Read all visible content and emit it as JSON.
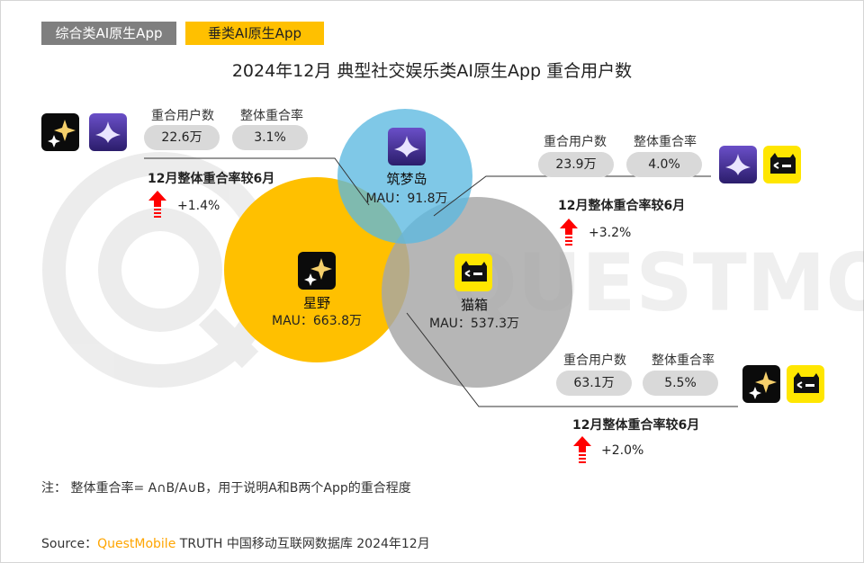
{
  "tags": {
    "general": "综合类AI原生App",
    "vertical": "垂类AI原生App"
  },
  "title": "2024年12月 典型社交娱乐类AI原生App 重合用户数",
  "watermark": "QUESTMOBILE",
  "colors": {
    "xingye": "#ffc000",
    "zhumengdao": "#5bb8e0",
    "maoxiang": "#a6a6a6",
    "arrow": "#ff0000",
    "brand": "#ffa500"
  },
  "chart_data": {
    "type": "venn",
    "sets": [
      {
        "name": "星野",
        "mau_label": "MAU：663.8万",
        "mau": 663.8,
        "icon": "sparkle-icon"
      },
      {
        "name": "筑梦岛",
        "mau_label": "MAU：91.8万",
        "mau": 91.8,
        "icon": "star-glow-icon"
      },
      {
        "name": "猫箱",
        "mau_label": "MAU：537.3万",
        "mau": 537.3,
        "icon": "cat-box-icon"
      }
    ],
    "overlaps": [
      {
        "pair": [
          "星野",
          "筑梦岛"
        ],
        "overlap_header": "重合用户数",
        "rate_header": "整体重合率",
        "overlap_label": "22.6万",
        "rate_label": "3.1%",
        "overlap_users": 22.6,
        "overlap_rate": 3.1,
        "compare_label": "12月整体重合率较6月",
        "delta_label": "+1.4%",
        "delta": 1.4
      },
      {
        "pair": [
          "筑梦岛",
          "猫箱"
        ],
        "overlap_header": "重合用户数",
        "rate_header": "整体重合率",
        "overlap_label": "23.9万",
        "rate_label": "4.0%",
        "overlap_users": 23.9,
        "overlap_rate": 4.0,
        "compare_label": "12月整体重合率较6月",
        "delta_label": "+3.2%",
        "delta": 3.2
      },
      {
        "pair": [
          "星野",
          "猫箱"
        ],
        "overlap_header": "重合用户数",
        "rate_header": "整体重合率",
        "overlap_label": "63.1万",
        "rate_label": "5.5%",
        "overlap_users": 63.1,
        "overlap_rate": 5.5,
        "compare_label": "12月整体重合率较6月",
        "delta_label": "+2.0%",
        "delta": 2.0
      }
    ]
  },
  "note": "注：  整体重合率= A∩B/A∪B，用于说明A和B两个App的重合程度",
  "source": {
    "prefix": "Source：",
    "brand": "QuestMobile",
    "rest": " TRUTH 中国移动互联网数据库 2024年12月"
  }
}
